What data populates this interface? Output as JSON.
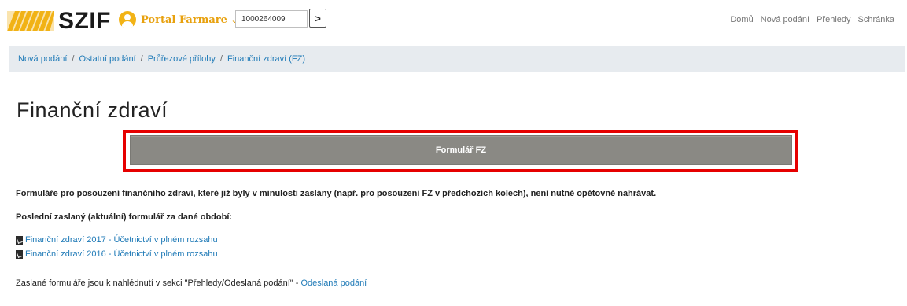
{
  "header": {
    "logo_text": "SZIF",
    "portal_label": "Portal Farmare",
    "id_value": "1000264009",
    "go_label": ">",
    "nav": [
      "Domů",
      "Nová podání",
      "Přehledy",
      "Schránka"
    ]
  },
  "breadcrumb": [
    "Nová podání",
    "Ostatní podání",
    "Průřezové přílohy",
    "Finanční zdraví (FZ)"
  ],
  "page_title": "Finanční zdraví",
  "form_button_label": "Formulář FZ",
  "notice_text": "Formuláře pro posouzení finančního zdraví, které již byly v minulosti zaslány (např. pro posouzení FZ v předchozích kolech), není nutné opětovně nahrávat.",
  "last_form_heading": "Poslední zaslaný (aktuální) formulář za dané období:",
  "documents": [
    "Finanční zdraví 2017 - Účetnictví v plném rozsahu",
    "Finanční zdraví 2016 - Účetnictví v plném rozsahu"
  ],
  "footer": {
    "text": "Zaslané formuláře jsou k nahlédnutí v sekci \"Přehledy/Odeslaná podání\" - ",
    "link": "Odeslaná podání"
  },
  "colors": {
    "accent_link": "#1f7ab7",
    "portal_orange": "#e8a10e",
    "highlight_red": "#e60000",
    "button_gray": "#8a8984"
  },
  "icons": {
    "logo": "szif-stripes-logo",
    "portal": "user-avatar-icon",
    "portal_dropdown": "chevron-down-icon",
    "document": "pdf-file-icon"
  }
}
